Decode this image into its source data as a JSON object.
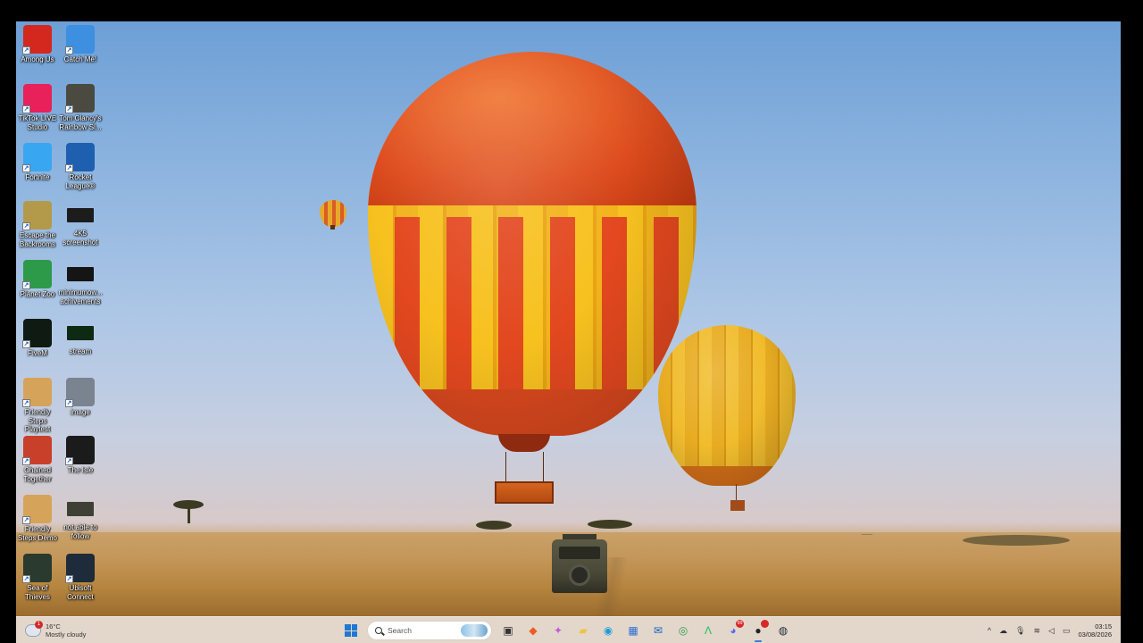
{
  "desktop": {
    "icons": [
      {
        "label": "Among Us",
        "icon": "among-us-icon",
        "color": "#d4281e"
      },
      {
        "label": "Catch Me!",
        "icon": "catch-me-icon",
        "color": "#3d8fe0"
      },
      {
        "label": "TikTok LIVE Studio",
        "icon": "tiktok-icon",
        "color": "#e9215a"
      },
      {
        "label": "Tom Clancy's Rainbow Si...",
        "icon": "rainbow-six-icon",
        "color": "#4a4a40"
      },
      {
        "label": "Fortnite",
        "icon": "fortnite-icon",
        "color": "#39a6f2"
      },
      {
        "label": "Rocket League®",
        "icon": "rocket-league-icon",
        "color": "#1e5fb0"
      },
      {
        "label": "Escape the Backrooms",
        "icon": "backrooms-icon",
        "color": "#b39a4a"
      },
      {
        "label": "4K5 screenshot",
        "icon": "screenshot-file-icon",
        "color": "#1c1c1c"
      },
      {
        "label": "Planet Zoo",
        "icon": "planet-zoo-icon",
        "color": "#2d9a4a"
      },
      {
        "label": "minimumow... achivements",
        "icon": "screenshot-file-icon",
        "color": "#151515"
      },
      {
        "label": "FiveM",
        "icon": "fivem-icon",
        "color": "#0f1a12"
      },
      {
        "label": "stream",
        "icon": "stream-file-icon",
        "color": "#0e2a12"
      },
      {
        "label": "Friendly Steps Playtest",
        "icon": "friendly-steps-icon",
        "color": "#d6a35a"
      },
      {
        "label": "image",
        "icon": "image-file-icon",
        "color": "#7a8390"
      },
      {
        "label": "Chained Together",
        "icon": "chained-together-icon",
        "color": "#c8402a"
      },
      {
        "label": "The Isle",
        "icon": "the-isle-icon",
        "color": "#1b1b1b"
      },
      {
        "label": "Friendly Steps Demo",
        "icon": "friendly-steps-icon",
        "color": "#d6a35a"
      },
      {
        "label": "not able to follow",
        "icon": "video-file-icon",
        "color": "#3f4035"
      },
      {
        "label": "Sea of Thieves",
        "icon": "sea-of-thieves-icon",
        "color": "#2a3a2e"
      },
      {
        "label": "Ubisoft Connect",
        "icon": "ubisoft-icon",
        "color": "#1d2b3a"
      }
    ]
  },
  "taskbar": {
    "weather": {
      "badge": "1",
      "temp": "16°C",
      "condition": "Mostly cloudy"
    },
    "search_placeholder": "Search",
    "apps": [
      {
        "name": "task-view-button",
        "icon": "task-view-icon",
        "glyph": "▣",
        "color": "#333333"
      },
      {
        "name": "brave-button",
        "icon": "brave-icon",
        "glyph": "◆",
        "color": "#f05a24"
      },
      {
        "name": "copilot-button",
        "icon": "copilot-icon",
        "glyph": "✦",
        "color": "#c45ad8"
      },
      {
        "name": "file-explorer-button",
        "icon": "folder-icon",
        "glyph": "▰",
        "color": "#f2c33a"
      },
      {
        "name": "edge-button",
        "icon": "edge-icon",
        "glyph": "◉",
        "color": "#1d9bd8"
      },
      {
        "name": "store-button",
        "icon": "store-icon",
        "glyph": "▦",
        "color": "#2a6fd0"
      },
      {
        "name": "outlook-button",
        "icon": "mail-icon",
        "glyph": "✉",
        "color": "#1565c0"
      },
      {
        "name": "chrome-button",
        "icon": "chrome-icon",
        "glyph": "◎",
        "color": "#2e9e4a"
      },
      {
        "name": "fivem-taskbar-button",
        "icon": "fivem-icon",
        "glyph": "Λ",
        "color": "#1ec05a"
      },
      {
        "name": "discord-button",
        "icon": "discord-icon",
        "glyph": "◕",
        "color": "#5865f2",
        "badge": "99"
      },
      {
        "name": "obs-button",
        "icon": "obs-icon",
        "glyph": "●",
        "color": "#222222",
        "badge": " ",
        "active": true
      },
      {
        "name": "steam-button",
        "icon": "steam-icon",
        "glyph": "◍",
        "color": "#1b2838"
      }
    ],
    "tray": {
      "chevron": "^",
      "time": "03:15",
      "date": "03/08/2026"
    }
  }
}
